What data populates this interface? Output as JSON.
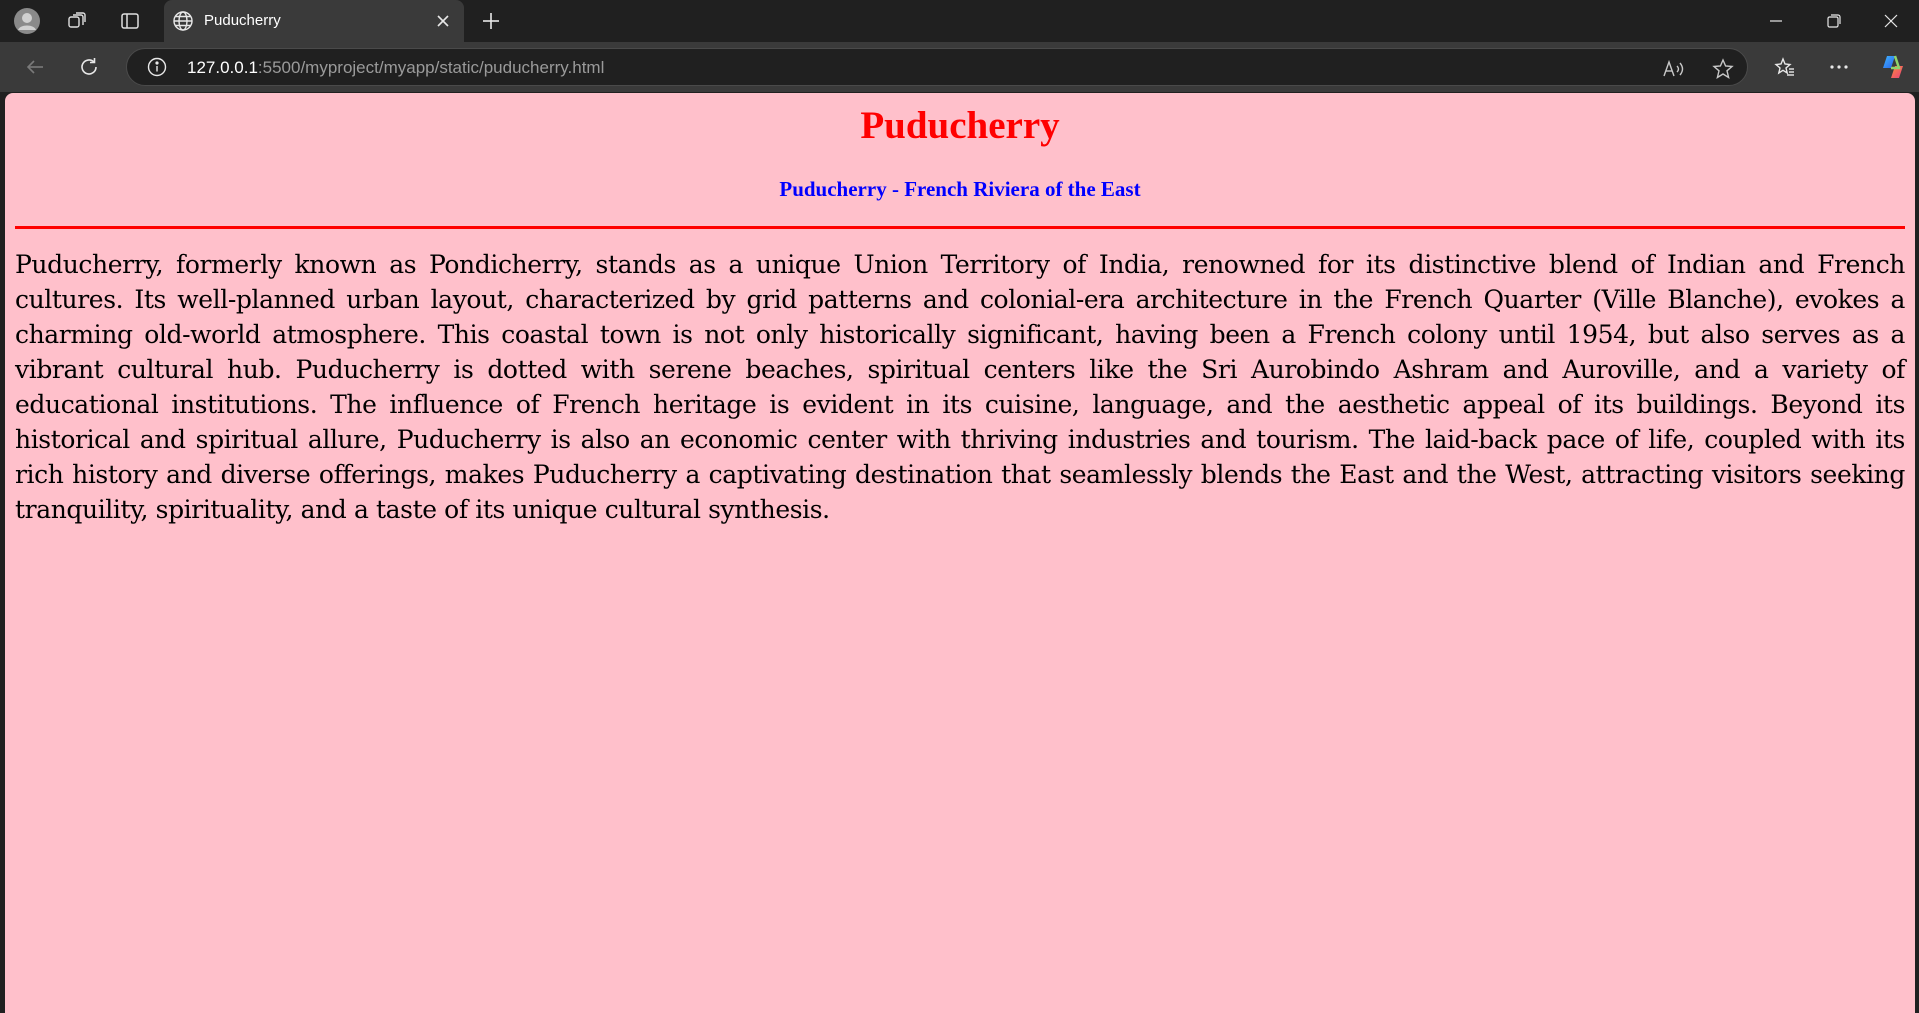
{
  "browser": {
    "tab": {
      "title": "Puducherry",
      "icon": "globe-icon"
    },
    "address_bar": {
      "host": "127.0.0.1",
      "rest": ":5500/myproject/myapp/static/puducherry.html"
    },
    "icons": {
      "profile": "avatar-icon",
      "workspaces": "workspaces-icon",
      "tab_actions": "tab-actions-icon",
      "close_tab": "close-icon",
      "new_tab": "plus-icon",
      "minimize": "minimize-icon",
      "restore": "restore-icon",
      "close_window": "close-icon",
      "back": "back-arrow-icon",
      "refresh": "refresh-icon",
      "site_info": "info-icon",
      "read_aloud": "read-aloud-icon",
      "favorite": "star-icon",
      "favorites": "favorites-icon",
      "menu": "more-icon",
      "copilot": "copilot-icon"
    }
  },
  "page": {
    "background": "#ffc0cb",
    "heading": "Puducherry",
    "heading_color": "#ff0000",
    "subheading": "Puducherry - French Riviera of the East",
    "subheading_color": "#0000ff",
    "rule_color": "#ff0000",
    "paragraph": "Puducherry, formerly known as Pondicherry, stands as a unique Union Territory of India, renowned for its distinctive blend of Indian and French cultures. Its well-planned urban layout, characterized by grid patterns and colonial-era architecture in the French Quarter (Ville Blanche), evokes a charming old-world atmosphere. This coastal town is not only historically significant, having been a French colony until 1954, but also serves as a vibrant cultural hub. Puducherry is dotted with serene beaches, spiritual centers like the Sri Aurobindo Ashram and Auroville, and a variety of educational institutions. The influence of French heritage is evident in its cuisine, language, and the aesthetic appeal of its buildings. Beyond its historical and spiritual allure, Puducherry is also an economic center with thriving industries and tourism. The laid-back pace of life, coupled with its rich history and diverse offerings, makes Puducherry a captivating destination that seamlessly blends the East and the West, attracting visitors seeking tranquility, spirituality, and a taste of its unique cultural synthesis."
  }
}
